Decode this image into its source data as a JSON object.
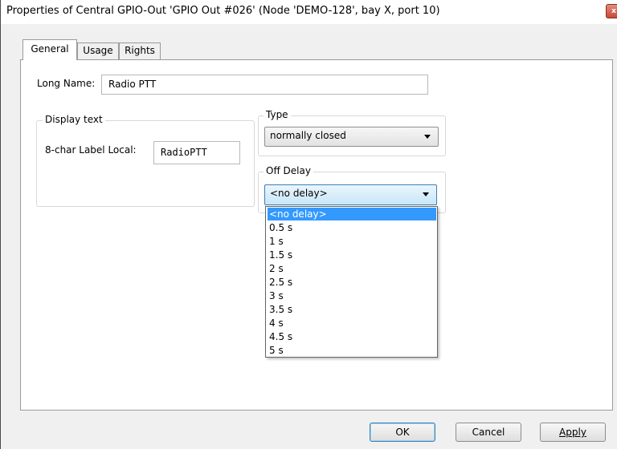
{
  "window": {
    "title": "Properties of Central GPIO-Out 'GPIO Out #026' (Node 'DEMO-128', bay X, port 10)",
    "close_label": "x"
  },
  "tabs": [
    {
      "label": "General",
      "active": true
    },
    {
      "label": "Usage",
      "active": false
    },
    {
      "label": "Rights",
      "active": false
    }
  ],
  "general": {
    "long_name_label": "Long Name:",
    "long_name_value": "Radio PTT",
    "display_group_title": "Display text",
    "label_local_label": "8-char Label Local:",
    "label_local_value": "RadioPTT",
    "type_group_title": "Type",
    "type_value": "normally closed",
    "off_delay_group_title": "Off Delay",
    "off_delay_value": "<no delay>",
    "off_delay_options": [
      "<no delay>",
      "0.5 s",
      "1 s",
      "1.5 s",
      "2 s",
      "2.5 s",
      "3 s",
      "3.5 s",
      "4 s",
      "4.5 s",
      "5 s"
    ],
    "off_delay_selected_index": 0
  },
  "buttons": {
    "ok": "OK",
    "cancel": "Cancel",
    "apply": "Apply"
  },
  "colors": {
    "selection": "#3399ff",
    "focus_border": "#3c7fb1"
  }
}
